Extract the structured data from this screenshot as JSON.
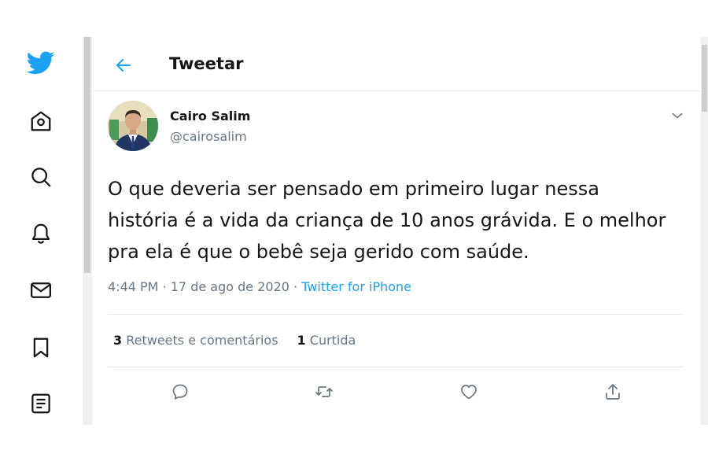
{
  "colors": {
    "accent": "#1da1f2",
    "text": "#14171a",
    "secondary": "#657786",
    "border": "#e6ecf0"
  },
  "sidebar": {
    "items": [
      {
        "icon": "twitter-logo-icon"
      },
      {
        "icon": "home-icon"
      },
      {
        "icon": "search-icon"
      },
      {
        "icon": "bell-icon"
      },
      {
        "icon": "mail-icon"
      },
      {
        "icon": "bookmark-icon"
      },
      {
        "icon": "list-icon"
      }
    ]
  },
  "header": {
    "title": "Tweetar",
    "back_icon": "arrow-left-icon"
  },
  "tweet": {
    "author_name": "Cairo Salim",
    "author_handle": "@cairosalim",
    "text": "O que deveria ser pensado em primeiro lugar nessa história é a vida da criança de 10 anos grávida. E o melhor pra ela é que o bebê seja gerido com saúde.",
    "time": "4:44 PM",
    "separator": "·",
    "date": "17 de ago de 2020",
    "source": "Twitter for iPhone",
    "retweets_count": "3",
    "retweets_label": "Retweets e comentários",
    "likes_count": "1",
    "likes_label": "Curtida"
  },
  "actions": [
    {
      "icon": "reply-icon"
    },
    {
      "icon": "retweet-icon"
    },
    {
      "icon": "like-icon"
    },
    {
      "icon": "share-icon"
    }
  ]
}
